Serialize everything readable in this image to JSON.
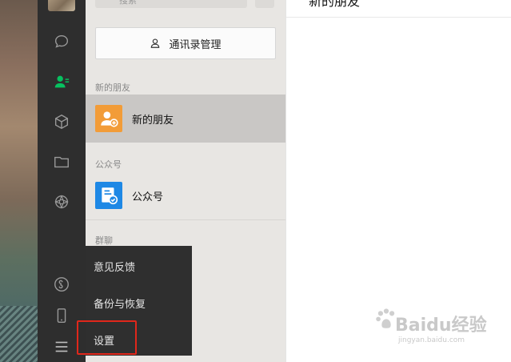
{
  "search": {
    "label": "搜索"
  },
  "toolbar": {
    "manage_label": "通讯录管理"
  },
  "sections": {
    "new_friends": {
      "label": "新的朋友",
      "item": "新的朋友"
    },
    "public_accounts": {
      "label": "公众号",
      "item": "公众号"
    },
    "groups": {
      "label": "群聊"
    }
  },
  "main": {
    "title": "新的朋友"
  },
  "menu": {
    "items": [
      "意见反馈",
      "备份与恢复",
      "设置"
    ]
  },
  "watermark": {
    "main": "Baidu经验",
    "sub": "jingyan.baidu.com"
  },
  "colors": {
    "accent_green": "#07c160",
    "sidebar": "#2e2e2e",
    "highlight": "#e0271b",
    "new_friend_icon": "#f29c38",
    "public_icon": "#1e88e5"
  },
  "icons": {
    "sidebar": [
      "chat-icon",
      "contacts-icon",
      "favorites-icon",
      "files-icon",
      "moments-icon",
      "miniprogram-icon",
      "phone-icon",
      "menu-icon"
    ]
  }
}
